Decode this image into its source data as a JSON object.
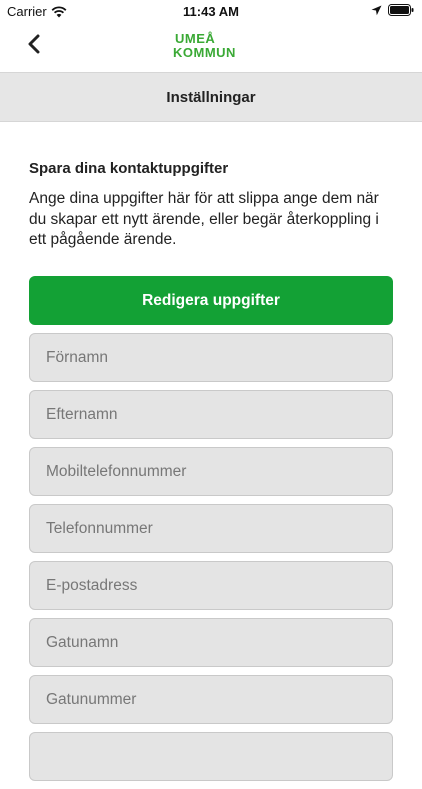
{
  "status_bar": {
    "carrier": "Carrier",
    "time": "11:43 AM"
  },
  "nav": {
    "back_icon": "chevron-left-icon",
    "logo_line1": "UMEÅ",
    "logo_line2": "KOMMUN",
    "logo_color": "#3aa935"
  },
  "header": {
    "title": "Inställningar"
  },
  "content": {
    "title": "Spara dina kontaktuppgifter",
    "description": "Ange dina uppgifter här för att slippa ange dem när du skapar ett nytt ärende, eller begär återkoppling i ett pågående ärende."
  },
  "edit_button": {
    "label": "Redigera uppgifter",
    "color": "#13a135"
  },
  "fields": [
    {
      "placeholder": "Förnamn"
    },
    {
      "placeholder": "Efternamn"
    },
    {
      "placeholder": "Mobiltelefonnummer"
    },
    {
      "placeholder": "Telefonnummer"
    },
    {
      "placeholder": "E-postadress"
    },
    {
      "placeholder": "Gatunamn"
    },
    {
      "placeholder": "Gatunummer"
    },
    {
      "placeholder": ""
    }
  ]
}
